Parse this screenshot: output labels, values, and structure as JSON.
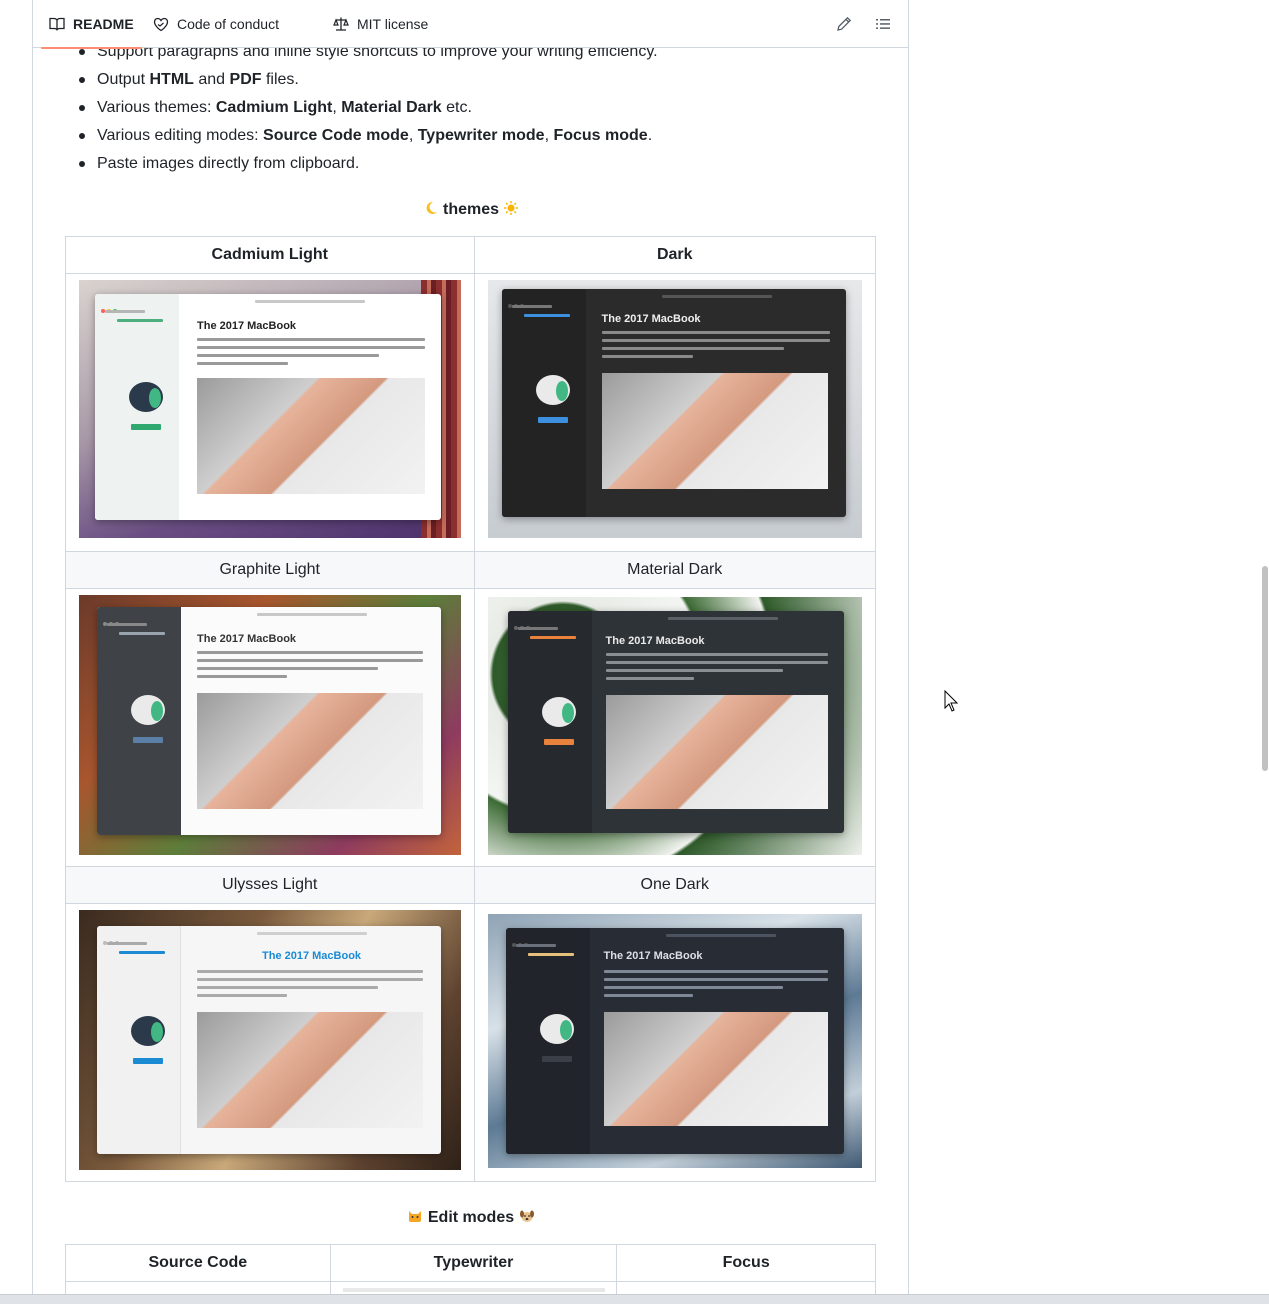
{
  "tabs": {
    "readme": "README",
    "code_of_conduct": "Code of conduct",
    "license": "MIT license"
  },
  "features": [
    {
      "pre": "Support paragraphs and inline style shortcuts to improve your writing efficiency.",
      "b1": "",
      "mid": "",
      "b2": "",
      "post": ""
    },
    {
      "pre": "Output ",
      "b1": "HTML",
      "mid": " and ",
      "b2": "PDF",
      "post": " files."
    },
    {
      "pre": "Various themes: ",
      "b1": "Cadmium Light",
      "mid": ", ",
      "b2": "Material Dark",
      "post": " etc."
    },
    {
      "pre": "Various editing modes: ",
      "b1": "Source Code mode",
      "mid": ", ",
      "b2": "Typewriter mode",
      "post": ", ",
      "b3": "Focus mode",
      "post2": "."
    },
    {
      "pre": "Paste images directly from clipboard.",
      "b1": "",
      "mid": "",
      "b2": "",
      "post": ""
    }
  ],
  "themes_section": {
    "title": "themes",
    "emoji_left": "crescent-moon",
    "emoji_right": "sun"
  },
  "themes_table": {
    "headers": [
      "Cadmium Light",
      "Dark"
    ],
    "row2": [
      "Graphite Light",
      "Material Dark"
    ],
    "row3": [
      "Ulysses Light",
      "One Dark"
    ],
    "screenshot": {
      "doc_title": "The 2017 MacBook",
      "breadcrumb": "Users › ransixi › Desktop › The 2017 MacBook.md",
      "opened_files": "Opened files",
      "file": "The 2017 MacBook.md",
      "open_folder": "Open Folder"
    }
  },
  "edit_modes_section": {
    "title": "Edit modes",
    "emoji_left": "cat-face",
    "emoji_right": "dog-face"
  },
  "edit_modes_table": {
    "headers": [
      "Source Code",
      "Typewriter",
      "Focus"
    ]
  },
  "colors": {
    "border": "#d0d7de",
    "tab_underline": "#fd8c73",
    "header_bg": "#f6f8fa",
    "text": "#1f2328"
  }
}
